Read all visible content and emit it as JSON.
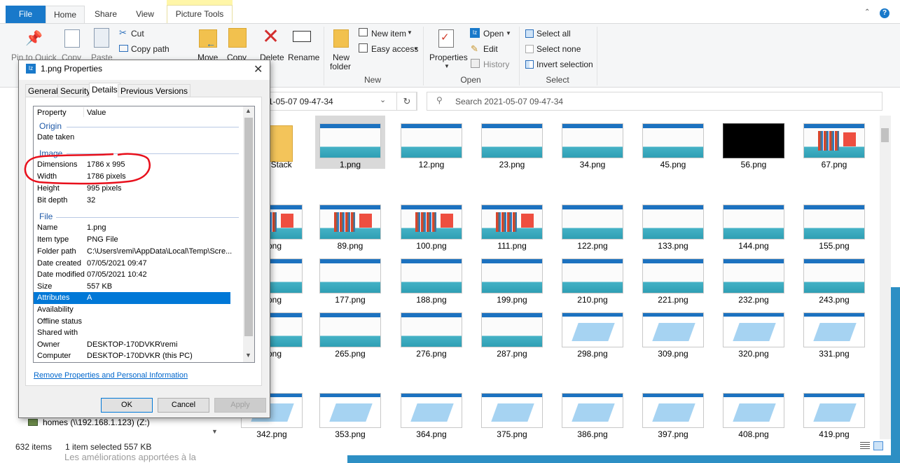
{
  "tabs": {
    "file": "File",
    "home": "Home",
    "share": "Share",
    "view": "View",
    "picture_tools": "Picture Tools"
  },
  "ribbon": {
    "pin": "Pin to Quick",
    "copy": "Copy",
    "paste": "Paste",
    "cut": "Cut",
    "copy_path": "Copy path",
    "move": "Move",
    "copy_to": "Copy",
    "delete": "Delete",
    "rename": "Rename",
    "new_folder": "New",
    "new_folder2": "folder",
    "new_item": "New item",
    "easy_access": "Easy access",
    "group_new": "New",
    "properties": "Properties",
    "open": "Open",
    "edit": "Edit",
    "history": "History",
    "group_open": "Open",
    "select_all": "Select all",
    "select_none": "Select none",
    "invert": "Invert selection",
    "group_select": "Select"
  },
  "address": {
    "path": "1-05-07 09-47-34",
    "search_placeholder": "Search 2021-05-07 09-47-34"
  },
  "files": [
    {
      "name": "nStack"
    },
    {
      "name": "1.png"
    },
    {
      "name": "12.png"
    },
    {
      "name": "23.png"
    },
    {
      "name": "34.png"
    },
    {
      "name": "45.png"
    },
    {
      "name": "56.png"
    },
    {
      "name": "67.png"
    },
    {
      "name": "png"
    },
    {
      "name": "89.png"
    },
    {
      "name": "100.png"
    },
    {
      "name": "111.png"
    },
    {
      "name": "122.png"
    },
    {
      "name": "133.png"
    },
    {
      "name": "144.png"
    },
    {
      "name": "155.png"
    },
    {
      "name": "png"
    },
    {
      "name": "177.png"
    },
    {
      "name": "188.png"
    },
    {
      "name": "199.png"
    },
    {
      "name": "210.png"
    },
    {
      "name": "221.png"
    },
    {
      "name": "232.png"
    },
    {
      "name": "243.png"
    },
    {
      "name": "png"
    },
    {
      "name": "265.png"
    },
    {
      "name": "276.png"
    },
    {
      "name": "287.png"
    },
    {
      "name": "298.png"
    },
    {
      "name": "309.png"
    },
    {
      "name": "320.png"
    },
    {
      "name": "331.png"
    },
    {
      "name": "342.png"
    },
    {
      "name": "353.png"
    },
    {
      "name": "364.png"
    },
    {
      "name": "375.png"
    },
    {
      "name": "386.png"
    },
    {
      "name": "397.png"
    },
    {
      "name": "408.png"
    },
    {
      "name": "419.png"
    }
  ],
  "nav": {
    "homes": "homes (\\\\192.168.1.123) (Z:)"
  },
  "status": {
    "items": "632 items",
    "selected": "1 item selected  557 KB"
  },
  "bottom_text": "Les améliorations apportées à la",
  "dialog": {
    "title": "1.png Properties",
    "tabs": [
      "General",
      "Security",
      "Details",
      "Previous Versions"
    ],
    "header": {
      "property": "Property",
      "value": "Value"
    },
    "sections": {
      "origin": "Origin",
      "image": "Image",
      "file": "File"
    },
    "rows": [
      {
        "k": "Date taken",
        "v": ""
      },
      {
        "k": "Dimensions",
        "v": "1786 x 995"
      },
      {
        "k": "Width",
        "v": "1786 pixels"
      },
      {
        "k": "Height",
        "v": "995 pixels"
      },
      {
        "k": "Bit depth",
        "v": "32"
      },
      {
        "k": "Name",
        "v": "1.png"
      },
      {
        "k": "Item type",
        "v": "PNG File"
      },
      {
        "k": "Folder path",
        "v": "C:\\Users\\remi\\AppData\\Local\\Temp\\Scre..."
      },
      {
        "k": "Date created",
        "v": "07/05/2021 09:47"
      },
      {
        "k": "Date modified",
        "v": "07/05/2021 10:42"
      },
      {
        "k": "Size",
        "v": "557 KB"
      },
      {
        "k": "Attributes",
        "v": "A"
      },
      {
        "k": "Availability",
        "v": ""
      },
      {
        "k": "Offline status",
        "v": ""
      },
      {
        "k": "Shared with",
        "v": ""
      },
      {
        "k": "Owner",
        "v": "DESKTOP-170DVKR\\remi"
      },
      {
        "k": "Computer",
        "v": "DESKTOP-170DVKR (this PC)"
      }
    ],
    "remove_link": "Remove Properties and Personal Information",
    "ok": "OK",
    "cancel": "Cancel",
    "apply": "Apply"
  },
  "colors": {
    "accent": "#1979ca",
    "selection": "#0078d7",
    "annotation": "#e8101c"
  }
}
